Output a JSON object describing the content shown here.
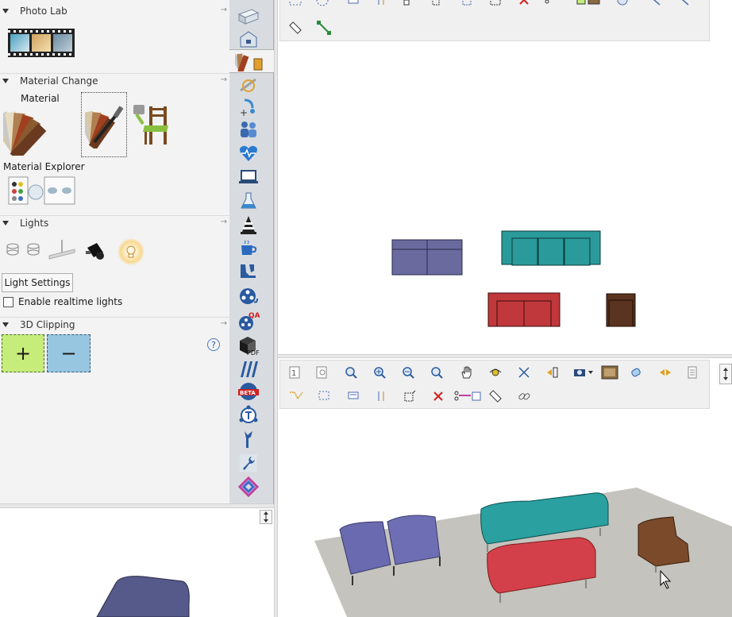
{
  "left_panel": {
    "photo_lab": {
      "title": "Photo Lab"
    },
    "material_change": {
      "title": "Material Change",
      "material_label": "Material",
      "explorer_label": "Material Explorer"
    },
    "lights": {
      "title": "Lights",
      "settings_button": "Light Settings",
      "realtime_checkbox": {
        "label": "Enable realtime lights",
        "checked": false
      }
    },
    "clipping": {
      "title": "3D Clipping",
      "add_symbol": "+",
      "remove_symbol": "−",
      "help_symbol": "?"
    }
  },
  "vertical_tabs": [
    "wall-icon",
    "house-icon",
    "material-tab-icon",
    "tools-icon",
    "plumbing-icon",
    "people-icon",
    "health-icon",
    "laptop-icon",
    "lab-flask-icon",
    "traffic-cone-icon",
    "coffee-icon",
    "shoe-icon",
    "film-reel-icon",
    "film-reel-qa-icon",
    "pdf-icon",
    "stripes-icon",
    "beta-icon",
    "text-tool-icon",
    "wrench-hand-icon",
    "wrench-icon",
    "link-shape-icon"
  ],
  "pdf_label": "PDF",
  "beta_label": "BETA",
  "qa_label": "QA",
  "colors": {
    "sofa_blue": "#6a6a9e",
    "sofa_teal": "#2a9a9a",
    "sofa_red": "#c0383c",
    "chair_brown": "#5a3420",
    "clip_add": "#c6ec7a",
    "clip_remove": "#96c6e0"
  }
}
